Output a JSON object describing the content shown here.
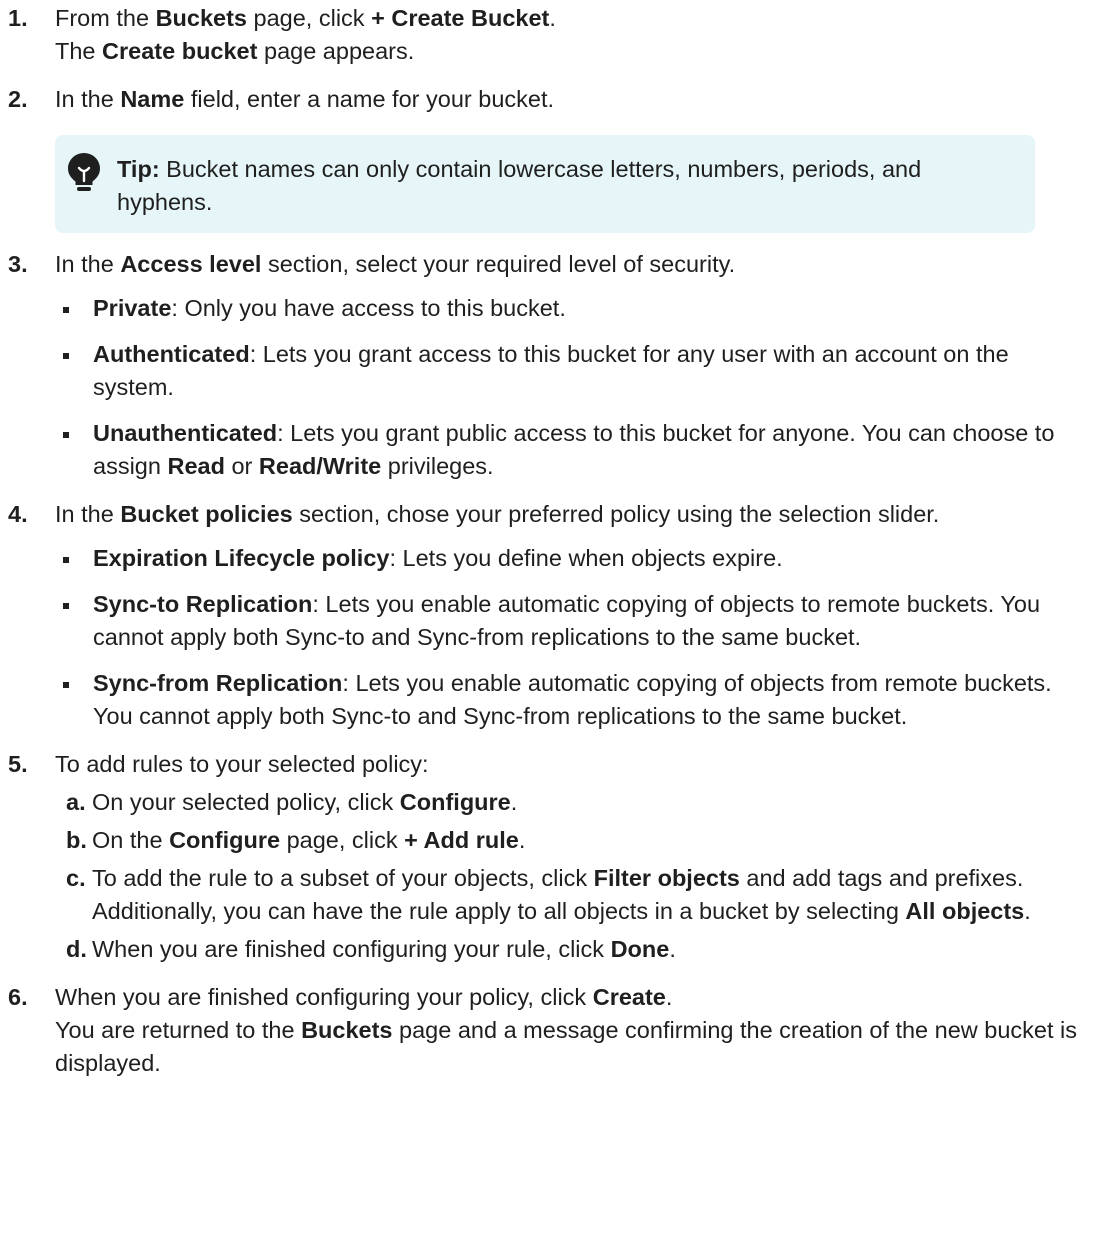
{
  "steps": [
    {
      "num": "1.",
      "t1": "From the ",
      "b1": "Buckets",
      "t2": " page, click ",
      "b2": "+ Create Bucket",
      "t3": ".",
      "t4": "The ",
      "b3": "Create bucket",
      "t5": " page appears."
    },
    {
      "num": "2.",
      "t1": "In the ",
      "b1": "Name",
      "t2": " field, enter a name for your bucket.",
      "tip": {
        "label": "Tip:",
        "text": " Bucket names can only contain lowercase letters, numbers, periods, and hyphens."
      }
    },
    {
      "num": "3.",
      "t1": "In the ",
      "b1": "Access level",
      "t2": " section, select your required level of security.",
      "bullets": [
        {
          "b": "Private",
          "t": ": Only you have access to this bucket."
        },
        {
          "b": "Authenticated",
          "t": ": Lets you grant access to this bucket for any user with an account on the system."
        },
        {
          "b": "Unauthenticated",
          "t": ": Lets you grant public access to this bucket for anyone. You can choose to assign ",
          "b2": "Read",
          "t2": " or ",
          "b3": "Read/Write",
          "t3": " privileges."
        }
      ]
    },
    {
      "num": "4.",
      "t1": "In the ",
      "b1": "Bucket policies",
      "t2": " section, chose your preferred policy using the selection slider.",
      "bullets": [
        {
          "b": "Expiration Lifecycle policy",
          "t": ": Lets you define when objects expire."
        },
        {
          "b": "Sync-to Replication",
          "t": ": Lets you enable automatic copying of objects to remote buckets. You cannot apply both Sync-to and Sync-from replications to the same bucket."
        },
        {
          "b": "Sync-from Replication",
          "t": ": Lets you enable automatic copying of objects from remote buckets. You cannot apply both Sync-to and Sync-from replications to the same bucket."
        }
      ]
    },
    {
      "num": "5.",
      "t1": "To add rules to your selected policy:",
      "sub": [
        {
          "l": "a.",
          "t1": "On your selected policy, click ",
          "b1": "Configure",
          "t2": "."
        },
        {
          "l": "b.",
          "t1": "On the ",
          "b1": "Configure",
          "t2": " page, click ",
          "b2": "+ Add rule",
          "t3": "."
        },
        {
          "l": "c.",
          "t1": "To add the rule to a subset of your objects, click ",
          "b1": "Filter objects",
          "t2": " and add tags and prefixes. Additionally, you can have the rule apply to all objects in a bucket by selecting ",
          "b2": "All objects",
          "t3": "."
        },
        {
          "l": "d.",
          "t1": "When you are finished configuring your rule, click ",
          "b1": "Done",
          "t2": "."
        }
      ]
    },
    {
      "num": "6.",
      "t1": "When you are finished configuring your policy, click ",
      "b1": "Create",
      "t2": ".",
      "t3": "You are returned to the ",
      "b2": "Buckets",
      "t4": " page and a message confirming the creation of the new bucket is displayed."
    }
  ],
  "colors": {
    "tip_bg": "#e6f6f8",
    "text": "#1f1f1f"
  },
  "icons": {
    "tip": "lightbulb-icon"
  }
}
